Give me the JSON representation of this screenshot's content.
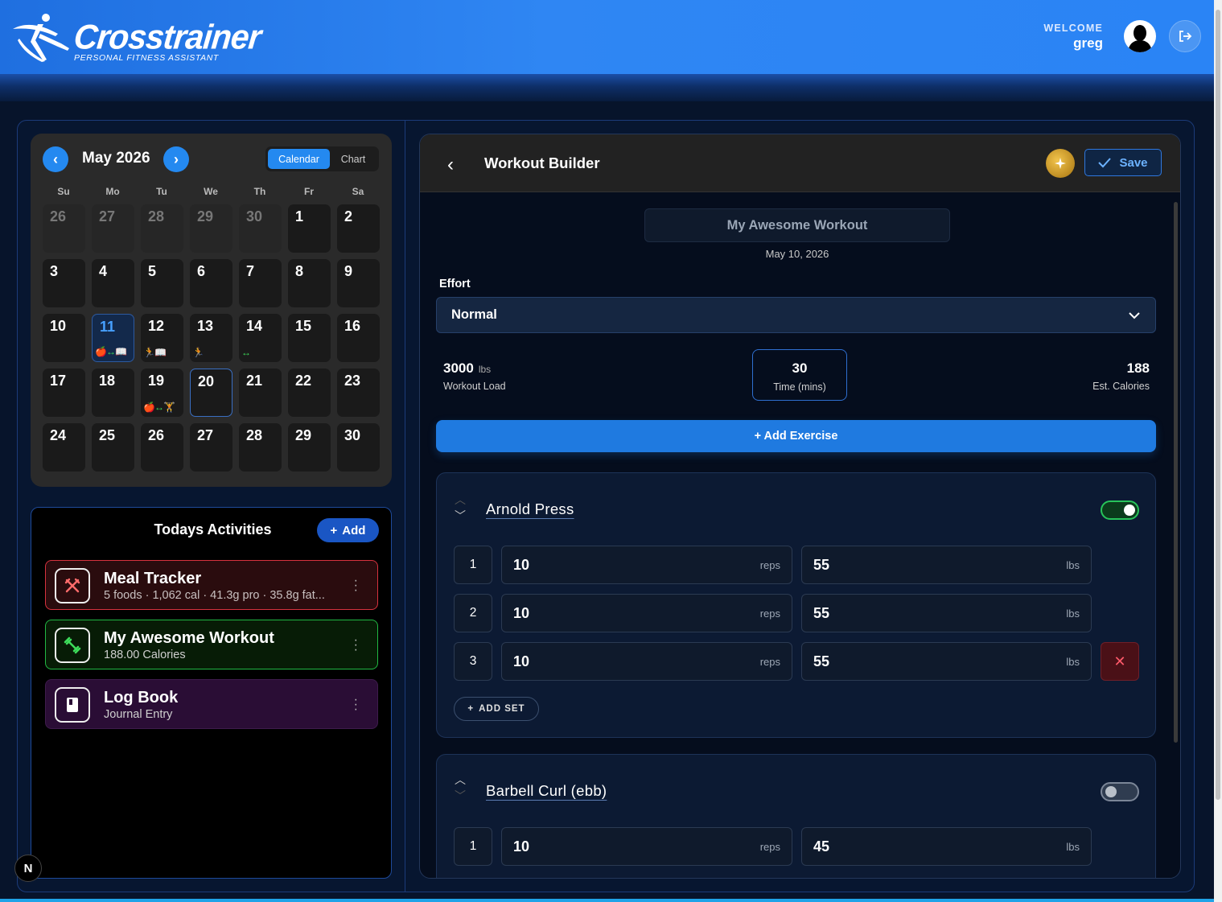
{
  "header": {
    "brand": "Crosstrainer",
    "tagline": "PERSONAL FITNESS ASSISTANT",
    "welcome_label": "WELCOME",
    "username": "greg"
  },
  "calendar": {
    "month_label": "May 2026",
    "view_toggle": {
      "active": "Calendar",
      "inactive": "Chart"
    },
    "weekdays": [
      "Su",
      "Mo",
      "Tu",
      "We",
      "Th",
      "Fr",
      "Sa"
    ],
    "weeks": [
      [
        {
          "d": "26",
          "muted": true
        },
        {
          "d": "27",
          "muted": true
        },
        {
          "d": "28",
          "muted": true
        },
        {
          "d": "29",
          "muted": true
        },
        {
          "d": "30",
          "muted": true
        },
        {
          "d": "1"
        },
        {
          "d": "2"
        }
      ],
      [
        {
          "d": "3"
        },
        {
          "d": "4"
        },
        {
          "d": "5"
        },
        {
          "d": "6"
        },
        {
          "d": "7"
        },
        {
          "d": "8"
        },
        {
          "d": "9"
        }
      ],
      [
        {
          "d": "10"
        },
        {
          "d": "11",
          "selected": true,
          "marks": "🍎↔📖"
        },
        {
          "d": "12",
          "marks": "🏃📖"
        },
        {
          "d": "13",
          "marks": "🏃"
        },
        {
          "d": "14",
          "marks": "↔"
        },
        {
          "d": "15"
        },
        {
          "d": "16"
        }
      ],
      [
        {
          "d": "17"
        },
        {
          "d": "18"
        },
        {
          "d": "19",
          "marks": "🍎↔🏋"
        },
        {
          "d": "20",
          "today": true
        },
        {
          "d": "21"
        },
        {
          "d": "22"
        },
        {
          "d": "23"
        }
      ],
      [
        {
          "d": "24"
        },
        {
          "d": "25"
        },
        {
          "d": "26"
        },
        {
          "d": "27"
        },
        {
          "d": "28"
        },
        {
          "d": "29"
        },
        {
          "d": "30"
        }
      ]
    ]
  },
  "activities": {
    "title": "Todays Activities",
    "add_label": "Add",
    "items": [
      {
        "title": "Meal Tracker",
        "subtitle": "5 foods · 1,062 cal · 41.3g pro · 35.8g fat...",
        "icon": "fork-knife-icon",
        "color": "#d7323e"
      },
      {
        "title": "My Awesome Workout",
        "subtitle": "188.00 Calories",
        "icon": "dumbbell-icon",
        "color": "#21b843"
      },
      {
        "title": "Log Book",
        "subtitle": "Journal Entry",
        "icon": "book-icon",
        "color": "#3e1b4c"
      }
    ]
  },
  "builder": {
    "title": "Workout Builder",
    "save_label": "Save",
    "workout_name": "My Awesome Workout",
    "workout_date": "May 10, 2026",
    "effort_label": "Effort",
    "effort_value": "Normal",
    "stats": {
      "load_value": "3000",
      "load_unit": "lbs",
      "load_label": "Workout Load",
      "time_value": "30",
      "time_label": "Time (mins)",
      "calories_value": "188",
      "calories_label": "Est. Calories"
    },
    "add_exercise_label": "+ Add Exercise",
    "add_set_label": "ADD SET",
    "reps_unit": "reps",
    "weight_unit": "lbs",
    "exercises": [
      {
        "name": "Arnold Press",
        "enabled": true,
        "sets": [
          {
            "n": "1",
            "reps": "10",
            "weight": "55"
          },
          {
            "n": "2",
            "reps": "10",
            "weight": "55"
          },
          {
            "n": "3",
            "reps": "10",
            "weight": "55"
          }
        ]
      },
      {
        "name": "Barbell Curl (ebb)",
        "enabled": false,
        "sets": [
          {
            "n": "1",
            "reps": "10",
            "weight": "45"
          }
        ]
      }
    ]
  },
  "dev_badge": "N",
  "colors": {
    "accent": "#2489f0",
    "meal": "#d7323e",
    "workout": "#21b843",
    "journal": "#3e1b4c",
    "save": "#6cb2ff"
  }
}
